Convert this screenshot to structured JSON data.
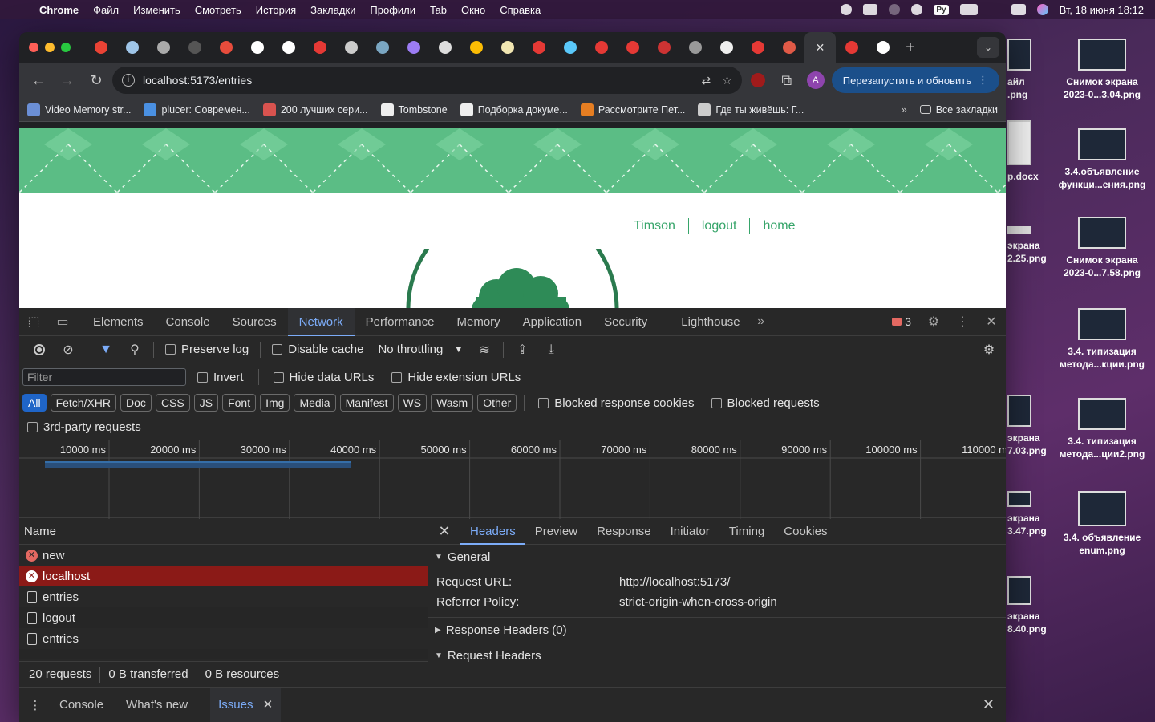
{
  "menubar": {
    "app": "Chrome",
    "items": [
      "Файл",
      "Изменить",
      "Смотреть",
      "История",
      "Закладки",
      "Профили",
      "Tab",
      "Окно",
      "Справка"
    ],
    "lang": "Ру",
    "clock": "Вт, 18 июня  18:12"
  },
  "desktop": {
    "items": [
      {
        "label": "Снимок экрана 2023-0...3.04.png"
      },
      {
        "label": "3.4.объявление функци...ения.png"
      },
      {
        "label": "Снимок экрана 2023-0...7.58.png"
      },
      {
        "label": "3.4. типизация метода...кции.png"
      },
      {
        "label": "3.4. типизация метода...ции2.png"
      },
      {
        "label": "3.4. объявление enum.png"
      }
    ],
    "partial": [
      {
        "label": "айл\n.png"
      },
      {
        "label": "p.docx"
      },
      {
        "label": "экрана\n2.25.png"
      },
      {
        "label": "экрана\n7.03.png"
      },
      {
        "label": "экрана\n3.47.png"
      },
      {
        "label": "экрана\n8.40.png"
      }
    ]
  },
  "browser": {
    "url": "localhost:5173/entries",
    "relaunch_label": "Перезапустить и обновить",
    "avatar_letter": "A",
    "bookmarks": [
      {
        "label": "Video Memory str...",
        "color": "#6b8fd6"
      },
      {
        "label": "plucer: Современ...",
        "color": "#4a90e2"
      },
      {
        "label": "200 лучших сери...",
        "color": "#d9534f"
      },
      {
        "label": "Tombstone",
        "color": "#eeeeee"
      },
      {
        "label": "Подборка докуме...",
        "color": "#eeeeee"
      },
      {
        "label": "Рассмотрите Пет...",
        "color": "#e67e22"
      },
      {
        "label": "Где ты живёшь: Г...",
        "color": "#cccccc"
      }
    ],
    "all_bookmarks": "Все закладки",
    "tab_colors": [
      "#ea4335",
      "#9fc5e8",
      "#aaaaaa",
      "#555555",
      "#e74c3c",
      "#ffffff",
      "#ffffff",
      "#e53935",
      "#cccccc",
      "#7aa6c2",
      "#9c7cf4",
      "#dddddd",
      "#fbbc04",
      "#f1e6b2",
      "#e53935",
      "#5ac8fa",
      "#e53935",
      "#e53935",
      "#cc3333",
      "#999999",
      "#eeeeee",
      "#e53935",
      "#e05a47",
      "#e53935",
      "#ffffff"
    ]
  },
  "page": {
    "nav": [
      "Timson",
      "logout",
      "home"
    ]
  },
  "devtools": {
    "tabs": [
      "Elements",
      "Console",
      "Sources",
      "Network",
      "Performance",
      "Memory",
      "Application",
      "Security",
      "Lighthouse"
    ],
    "active_tab": "Network",
    "issues_count": "3",
    "toolbar": {
      "preserve_log": "Preserve log",
      "disable_cache": "Disable cache",
      "throttling": "No throttling"
    },
    "filter": {
      "placeholder": "Filter",
      "invert": "Invert",
      "hide_data_urls": "Hide data URLs",
      "hide_extension_urls": "Hide extension URLs"
    },
    "types": [
      "All",
      "Fetch/XHR",
      "Doc",
      "CSS",
      "JS",
      "Font",
      "Img",
      "Media",
      "Manifest",
      "WS",
      "Wasm",
      "Other"
    ],
    "blocked_response_cookies": "Blocked response cookies",
    "blocked_requests": "Blocked requests",
    "third_party": "3rd-party requests",
    "timeline_labels": [
      "10000 ms",
      "20000 ms",
      "30000 ms",
      "40000 ms",
      "50000 ms",
      "60000 ms",
      "70000 ms",
      "80000 ms",
      "90000 ms",
      "100000 ms",
      "110000 m"
    ],
    "requests_header": "Name",
    "requests": [
      {
        "name": "new",
        "kind": "error"
      },
      {
        "name": "localhost",
        "kind": "error",
        "selected": true
      },
      {
        "name": "entries",
        "kind": "doc"
      },
      {
        "name": "logout",
        "kind": "doc"
      },
      {
        "name": "entries",
        "kind": "doc"
      }
    ],
    "status": {
      "requests": "20 requests",
      "transferred": "0 B transferred",
      "resources": "0 B resources"
    },
    "detail_tabs": [
      "Headers",
      "Preview",
      "Response",
      "Initiator",
      "Timing",
      "Cookies"
    ],
    "general": {
      "title": "General",
      "rows": [
        {
          "k": "Request URL:",
          "v": "http://localhost:5173/"
        },
        {
          "k": "Referrer Policy:",
          "v": "strict-origin-when-cross-origin"
        }
      ]
    },
    "response_headers": "Response Headers (0)",
    "request_headers": "Request Headers",
    "drawer": {
      "tabs": [
        "Console",
        "What's new",
        "Issues"
      ],
      "active": "Issues"
    }
  }
}
